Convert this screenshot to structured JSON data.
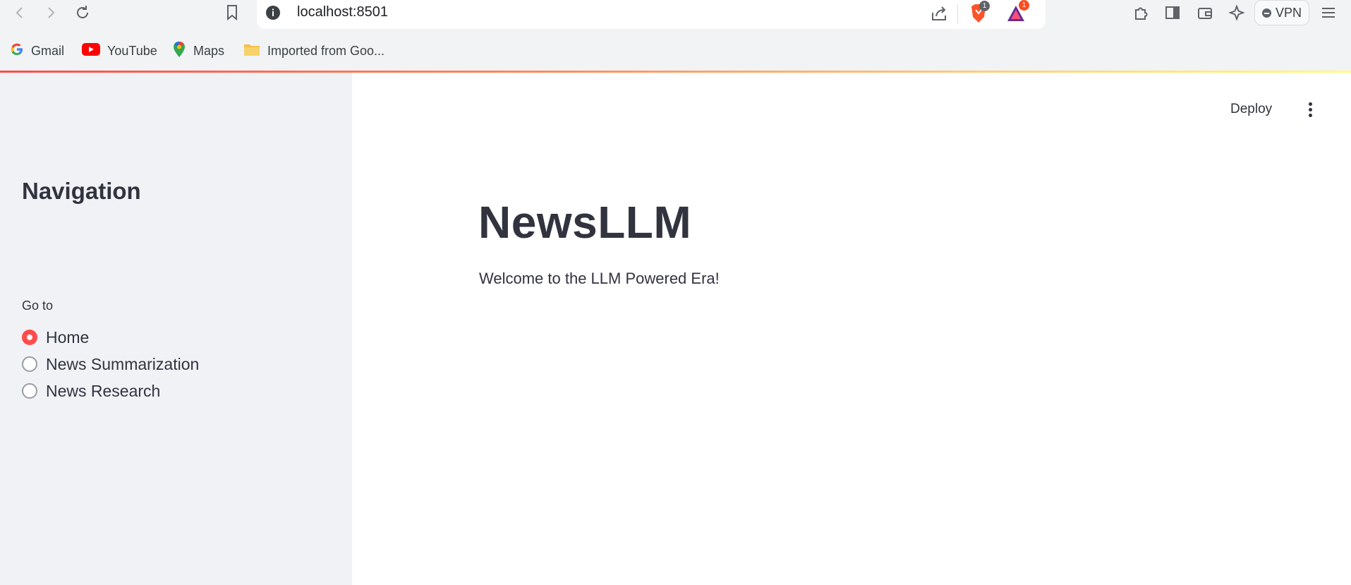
{
  "browser": {
    "url": "localhost:8501",
    "brave_badge": "1",
    "rewards_badge": "1",
    "vpn_label": "VPN",
    "accent_red": "#ff4b4b",
    "icons": [
      "back-icon",
      "forward-icon",
      "reload-icon",
      "bookmark-icon",
      "site-info-icon",
      "share-icon",
      "brave-shields-icon",
      "brave-rewards-icon",
      "extensions-icon",
      "sidebar-icon",
      "wallet-icon",
      "leo-ai-icon",
      "menu-icon"
    ]
  },
  "bookmarks": [
    {
      "label": "Gmail",
      "icon": "google-icon"
    },
    {
      "label": "YouTube",
      "icon": "youtube-icon"
    },
    {
      "label": "Maps",
      "icon": "maps-icon"
    },
    {
      "label": "Imported from Goo...",
      "icon": "folder-icon"
    }
  ],
  "sidebar": {
    "title": "Navigation",
    "radio_label": "Go to",
    "options": [
      {
        "label": "Home",
        "selected": true
      },
      {
        "label": "News Summarization",
        "selected": false
      },
      {
        "label": "News Research",
        "selected": false
      }
    ]
  },
  "header": {
    "deploy_label": "Deploy"
  },
  "main": {
    "title": "NewsLLM",
    "subtitle": "Welcome to the LLM Powered Era!"
  }
}
